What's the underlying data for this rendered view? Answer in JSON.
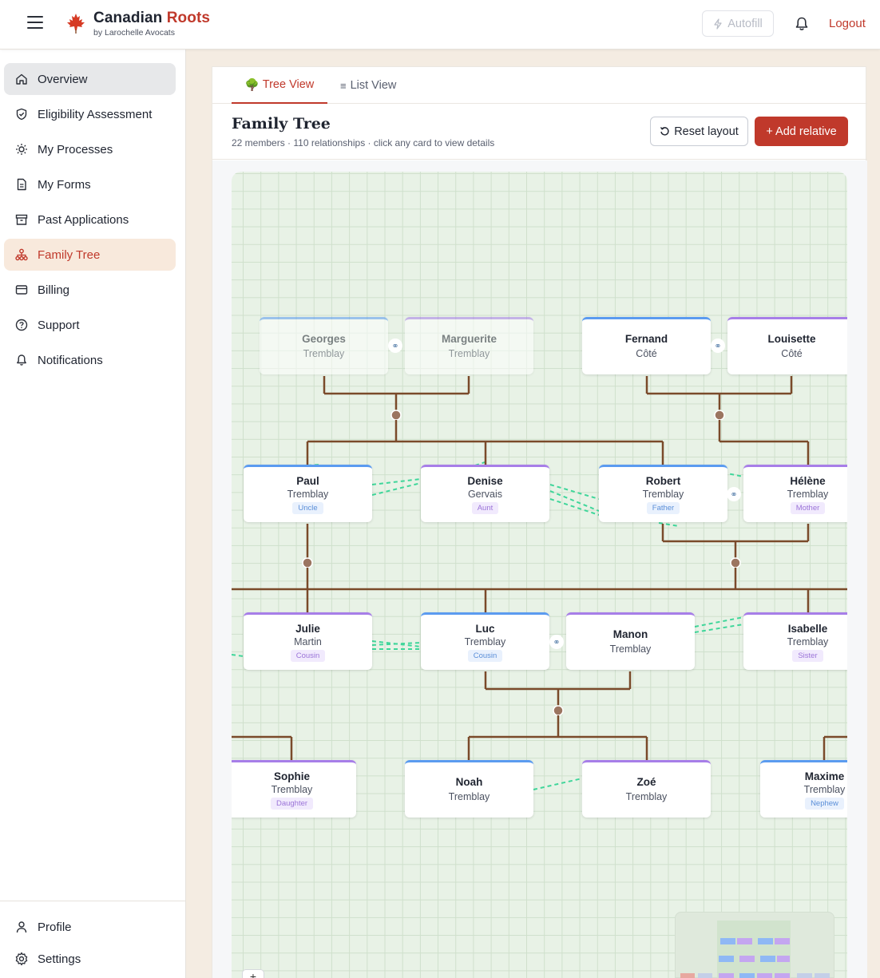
{
  "header": {
    "brand_name": "Canadian",
    "brand_accent": "Roots",
    "brand_sub": "by Larochelle Avocats",
    "autofill_label": "Autofill",
    "logout_label": "Logout"
  },
  "sidebar": {
    "items": [
      {
        "label": "Overview",
        "icon": "home-icon"
      },
      {
        "label": "Eligibility Assessment",
        "icon": "shield-check-icon"
      },
      {
        "label": "My Processes",
        "icon": "sun-icon"
      },
      {
        "label": "My Forms",
        "icon": "document-icon"
      },
      {
        "label": "Past Applications",
        "icon": "archive-icon"
      },
      {
        "label": "Family Tree",
        "icon": "tree-icon"
      },
      {
        "label": "Billing",
        "icon": "credit-card-icon"
      },
      {
        "label": "Support",
        "icon": "help-circle-icon"
      },
      {
        "label": "Notifications",
        "icon": "bell-icon"
      }
    ],
    "bottom": [
      {
        "label": "Profile",
        "icon": "user-icon"
      },
      {
        "label": "Settings",
        "icon": "gear-icon"
      }
    ]
  },
  "tabs": [
    {
      "label": "Tree View",
      "icon": "tree-emoji"
    },
    {
      "label": "List View",
      "icon": "list-icon"
    }
  ],
  "tree_view": {
    "title": "Family Tree",
    "subtitle": "22 members · 110 relationships · click any card to view details",
    "reset_label": "Reset layout",
    "add_label": "+ Add relative"
  },
  "people": [
    {
      "first": "Georges",
      "last": "Tremblay",
      "role": "",
      "sex": "m",
      "dim": true
    },
    {
      "first": "Marguerite",
      "last": "Tremblay",
      "role": "",
      "sex": "f",
      "dim": true
    },
    {
      "first": "Fernand",
      "last": "Côté",
      "role": "",
      "sex": "m",
      "dim": false
    },
    {
      "first": "Louisette",
      "last": "Côté",
      "role": "",
      "sex": "f",
      "dim": false
    },
    {
      "first": "Paul",
      "last": "Tremblay",
      "role": "Uncle",
      "sex": "m",
      "dim": false
    },
    {
      "first": "Denise",
      "last": "Gervais",
      "role": "Aunt",
      "sex": "f",
      "dim": false
    },
    {
      "first": "Robert",
      "last": "Tremblay",
      "role": "Father",
      "sex": "m",
      "dim": false
    },
    {
      "first": "Hélène",
      "last": "Tremblay",
      "role": "Mother",
      "sex": "f",
      "dim": false
    },
    {
      "first": "Julie",
      "last": "Martin",
      "role": "Cousin",
      "sex": "f",
      "dim": false
    },
    {
      "first": "Luc",
      "last": "Tremblay",
      "role": "Cousin",
      "sex": "m",
      "dim": false
    },
    {
      "first": "Manon",
      "last": "Tremblay",
      "role": "",
      "sex": "f",
      "dim": false
    },
    {
      "first": "Isabelle",
      "last": "Tremblay",
      "role": "Sister",
      "sex": "f",
      "dim": false
    },
    {
      "first": "Sophie",
      "last": "Tremblay",
      "role": "Daughter",
      "sex": "f",
      "dim": false
    },
    {
      "first": "Noah",
      "last": "Tremblay",
      "role": "",
      "sex": "m",
      "dim": false
    },
    {
      "first": "Zoé",
      "last": "Tremblay",
      "role": "",
      "sex": "f",
      "dim": false
    },
    {
      "first": "Maxime",
      "last": "Tremblay",
      "role": "Nephew",
      "sex": "m",
      "dim": false
    }
  ],
  "zoom_in_label": "+",
  "colors": {
    "accent": "#c0392b",
    "male": "#5b9bf0",
    "female": "#a77ee8",
    "link": "#7a4a2a",
    "spouse_link": "#3fd69a"
  }
}
